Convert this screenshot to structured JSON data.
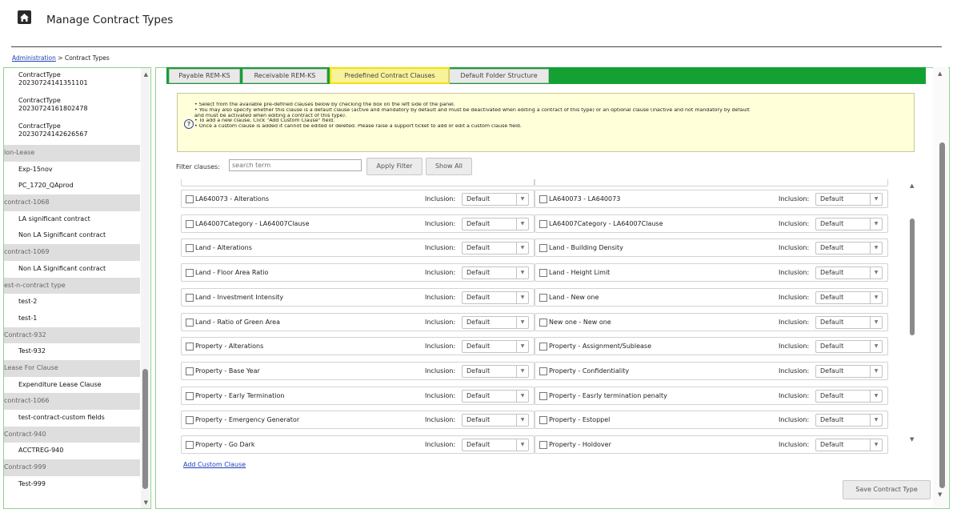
{
  "header": {
    "title": "Manage Contract Types",
    "home_icon": "home-icon"
  },
  "breadcrumb": {
    "link": "Administration",
    "separator": " > ",
    "current": "Contract Types"
  },
  "sidebar": {
    "rows": [
      {
        "kind": "item2",
        "line1": "ContractType",
        "line2": "20230724141351101"
      },
      {
        "kind": "item2",
        "line1": "ContractType",
        "line2": "20230724161802478"
      },
      {
        "kind": "item2",
        "line1": "ContractType",
        "line2": "20230724142626567"
      },
      {
        "kind": "group",
        "label": "lon-Lease"
      },
      {
        "kind": "item",
        "label": "Exp-15nov"
      },
      {
        "kind": "item",
        "label": "PC_1720_QAprod"
      },
      {
        "kind": "group",
        "label": "contract-1068"
      },
      {
        "kind": "item",
        "label": "LA significant contract"
      },
      {
        "kind": "item",
        "label": "Non LA Significant contract"
      },
      {
        "kind": "group",
        "label": "contract-1069"
      },
      {
        "kind": "item",
        "label": "Non LA Significant contract"
      },
      {
        "kind": "group",
        "label": "est-n-contract type"
      },
      {
        "kind": "item",
        "label": "test-2"
      },
      {
        "kind": "item",
        "label": "test-1"
      },
      {
        "kind": "group",
        "label": "Contract-932"
      },
      {
        "kind": "item",
        "label": "Test-932"
      },
      {
        "kind": "group",
        "label": "Lease For Clause"
      },
      {
        "kind": "item",
        "label": "Expenditure Lease Clause"
      },
      {
        "kind": "group",
        "label": "contract-1066"
      },
      {
        "kind": "item",
        "label": "test-contract-custom fields"
      },
      {
        "kind": "group",
        "label": "Contract-940"
      },
      {
        "kind": "item",
        "label": "ACCTREG-940"
      },
      {
        "kind": "group",
        "label": "Contract-999"
      },
      {
        "kind": "item",
        "label": "Test-999"
      }
    ]
  },
  "tabs": [
    {
      "label": "Payable REM-KS",
      "active": false
    },
    {
      "label": "Receivable REM-KS",
      "active": false
    },
    {
      "label": "Predefined Contract Clauses",
      "active": true
    },
    {
      "label": "Default Folder Structure",
      "active": false
    }
  ],
  "info": {
    "lines": [
      "•  Select from the available pre-defined clauses below by checking the box on the left side of the panel.",
      "•  You may also specify whether this clause is a default clause (active and mandatory by default and must be deactivated when editing a contract of this type) or an optional clause (inactive and not mandatory by default",
      "    and must be activated when editing a contract of this type).",
      "•  To add a new clause, Click \"Add Custom Clause\" field.",
      "•  Once a custom clause is added it cannot be edited or deleted. Please raise a support ticket to add or edit a custom clause field."
    ]
  },
  "filter": {
    "label": "Filter clauses:",
    "placeholder": "search term",
    "apply_label": "Apply Filter",
    "show_all_label": "Show All"
  },
  "clauses": {
    "inclusion_label": "Inclusion:",
    "default_value": "Default",
    "left": [
      "LA640073 - Alterations",
      "LA64007Category - LA64007Clause",
      "Land - Alterations",
      "Land - Floor Area Ratio",
      "Land - Investment Intensity",
      "Land - Ratio of Green Area",
      "Property - Alterations",
      "Property - Base Year",
      "Property - Early Termination",
      "Property - Emergency Generator",
      "Property - Go Dark"
    ],
    "right": [
      "LA640073 - LA640073",
      "LA64007Category - LA64007Clause",
      "Land - Building Density",
      "Land - Height Limit",
      "Land - New one",
      "New one - New one",
      "Property - Assignment/Sublease",
      "Property - Confidentiality",
      "Property - Easrly termination penalty",
      "Property - Estoppel",
      "Property - Holdover"
    ]
  },
  "add_custom_label": "Add Custom Clause",
  "save_label": "Save Contract Type"
}
